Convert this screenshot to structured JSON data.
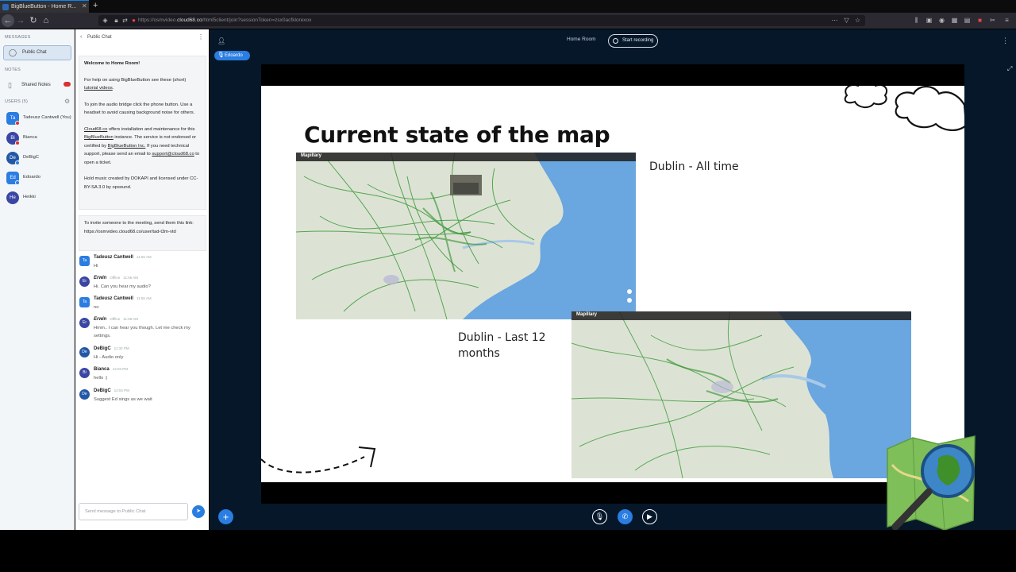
{
  "browser": {
    "tab_title": "BigBlueButton - Home R...",
    "url_prefix": "https://osmvideo.",
    "url_domain": "cloud68.co",
    "url_suffix": "/html5client/join?sessionToken=zsx0acfklorexox"
  },
  "sidebar": {
    "messages_header": "MESSAGES",
    "public_chat": "Public Chat",
    "notes_header": "NOTES",
    "shared_notes": "Shared Notes",
    "users_header": "USERS (5)",
    "users": [
      {
        "initials": "Ta",
        "name": "Tadeusz Cantwell (You)",
        "color": "#2a7de1"
      },
      {
        "initials": "Bi",
        "name": "Bianca",
        "color": "#3a46a3"
      },
      {
        "initials": "De",
        "name": "DeBigC",
        "color": "#2358a6"
      },
      {
        "initials": "Ed",
        "name": "Edoardo",
        "color": "#2a7de1"
      },
      {
        "initials": "He",
        "name": "Heikki",
        "color": "#3a46a3"
      }
    ]
  },
  "chat": {
    "header": "Public Chat",
    "welcome": {
      "title_prefix": "Welcome to ",
      "title_room": "Home Room",
      "title_suffix": "!",
      "p1_a": "For help on using BigBlueButton see these (short) ",
      "p1_link": "tutorial videos",
      "p1_b": ".",
      "p2": "To join the audio bridge click the phone button. Use a headset to avoid causing background noise for others.",
      "p3_link1": "Cloud68.co",
      "p3_a": " offers installation and maintenance for this ",
      "p3_link2": "BigBlueButton",
      "p3_b": " instance. The service is not endorsed or certified by ",
      "p3_link3": "BigBlueButton Inc.",
      "p3_c": " If you need technical support, please send an email to ",
      "p3_link4": "support@cloud68.co",
      "p3_d": " to open a ticket.",
      "p4": "Hold music created by DOKAPI and licensed under CC-BY-SA 3.0 by opsound."
    },
    "invite": "To invite someone to the meeting, send them this link: https://osmvideo.cloud68.co/user/tad-t3m-vtd",
    "messages": [
      {
        "initials": "Ta",
        "color": "#2a7de1",
        "name": "Tadeusz Cantwell",
        "time": "11:55 AM",
        "text": "Hi"
      },
      {
        "initials": "Er",
        "color": "#3a46a3",
        "name": "Erwin",
        "status": "Offline",
        "time": "11:56 AM",
        "text": "Hi. Can you hear my audio?"
      },
      {
        "initials": "Ta",
        "color": "#2a7de1",
        "name": "Tadeusz Cantwell",
        "time": "11:56 AM",
        "text": "no"
      },
      {
        "initials": "Er",
        "color": "#3a46a3",
        "name": "Erwin",
        "status": "Offline",
        "time": "11:58 AM",
        "text": "Hmm.. I can hear you though. Let me check my settings."
      },
      {
        "initials": "De",
        "color": "#2358a6",
        "name": "DeBigC",
        "time": "11:32 PM",
        "text": "Hi - Audio only"
      },
      {
        "initials": "Bi",
        "color": "#3a46a3",
        "name": "Bianca",
        "time": "12:03 PM",
        "text": "hello :)"
      },
      {
        "initials": "De",
        "color": "#2358a6",
        "name": "DeBigC",
        "time": "12:04 PM",
        "text": "Suggest Ed sings as we wait"
      }
    ],
    "input_placeholder": "Send message to Public Chat"
  },
  "main": {
    "room_name": "Home Room",
    "record_label": "Start recording",
    "talker": "Edoardo"
  },
  "slide": {
    "title": "Current state of the map",
    "label_alltime": "Dublin - All time",
    "label_last12": "Dublin - Last 12 months",
    "map_brand": "Mapillary"
  },
  "colors": {
    "primary": "#2a7de1",
    "main_bg": "#06172a",
    "map_land": "#dde3d4",
    "map_sea": "#6aa6df",
    "map_track": "#3a9a3a"
  }
}
